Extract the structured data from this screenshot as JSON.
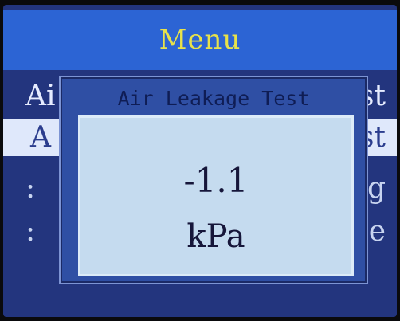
{
  "header": {
    "title": "Menu"
  },
  "menu": {
    "items": [
      {
        "left": "Ai",
        "right": "st"
      },
      {
        "left": "A",
        "right": "st"
      },
      {
        "left": ":",
        "right": "g"
      },
      {
        "left": ":",
        "right": "e"
      }
    ]
  },
  "dialog": {
    "title": "Air Leakage Test",
    "value": "-1.1",
    "unit": "kPa"
  }
}
